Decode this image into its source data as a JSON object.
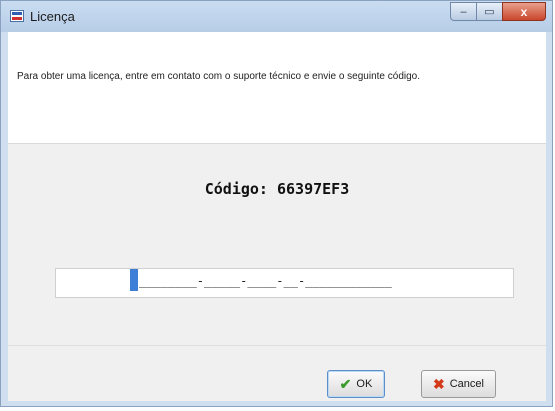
{
  "window": {
    "title": "Licença",
    "app_icon": "app-logo-icon",
    "caption_buttons": {
      "minimize_icon": "minimize-icon",
      "maximize_icon": "maximize-icon",
      "close_icon": "close-icon",
      "minimize_glyph": "–",
      "maximize_glyph": "▭",
      "close_glyph": "x"
    }
  },
  "content": {
    "instruction": "Para obter uma licença, entre em contato com o suporte técnico e envie o seguinte código.",
    "code_label": "Código:",
    "code_value": "66397EF3"
  },
  "license_input": {
    "mask": "________-_____-____-__-____________"
  },
  "buttons": {
    "ok_label": "OK",
    "ok_icon": "checkmark-icon",
    "cancel_label": "Cancel",
    "cancel_icon": "red-x-icon"
  },
  "colors": {
    "title_bar": "#c9dcf1",
    "close_button": "#c9462a",
    "caret": "#3d7fd6"
  }
}
